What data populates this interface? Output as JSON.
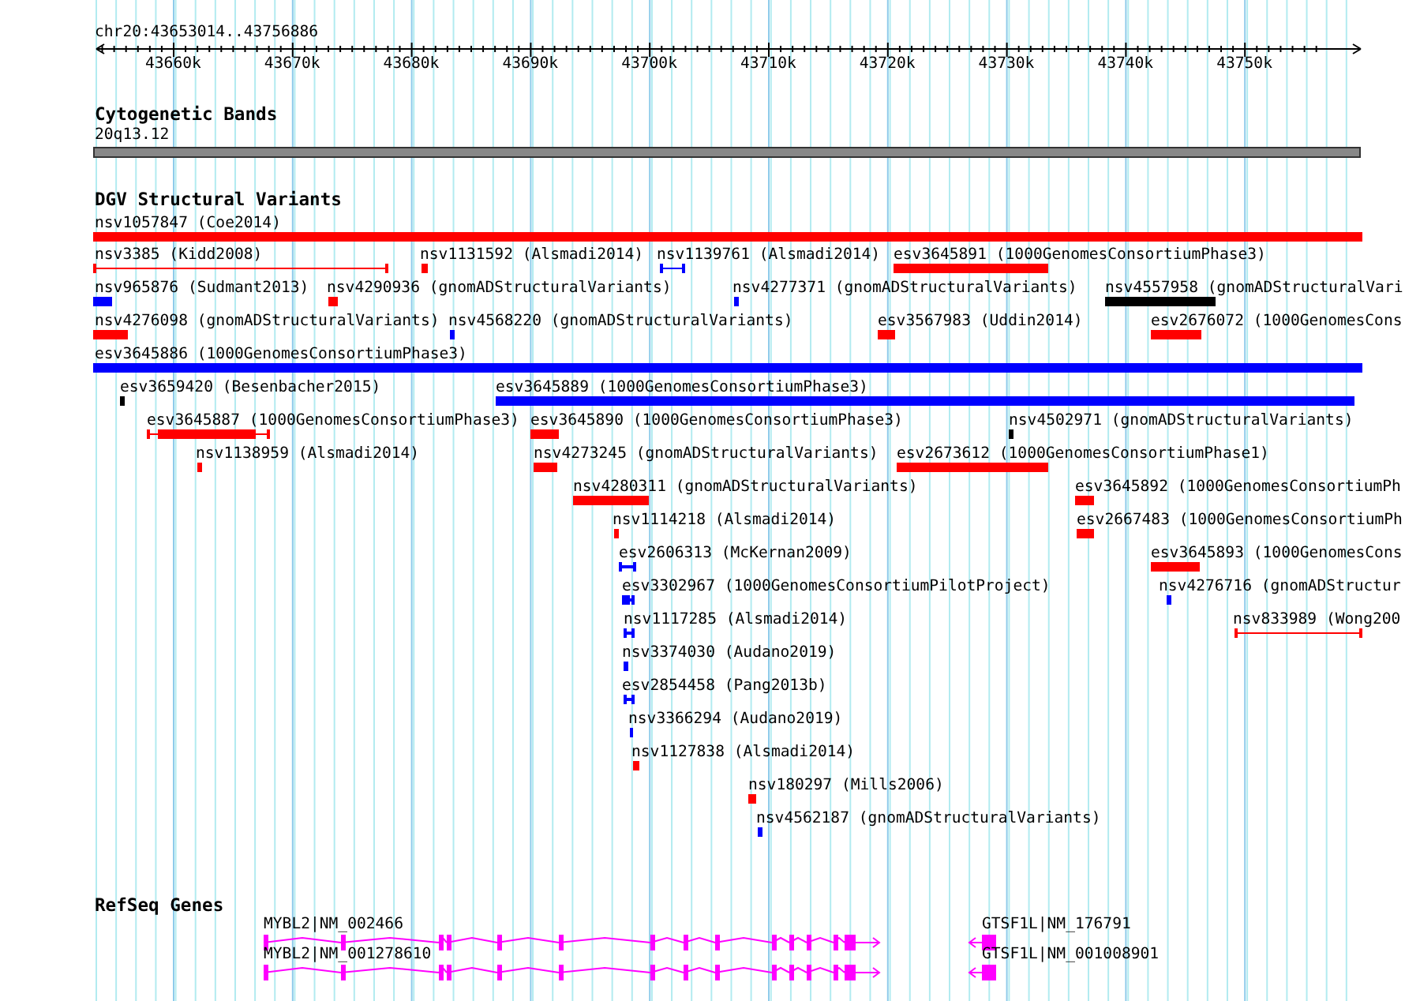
{
  "ruler": {
    "location": "chr20:43653014..43756886",
    "ticks": [
      "43660k",
      "43670k",
      "43680k",
      "43690k",
      "43700k",
      "43710k",
      "43720k",
      "43730k",
      "43740k",
      "43750k"
    ]
  },
  "cytobands": {
    "title": "Cytogenetic Bands",
    "band": "20q13.12"
  },
  "variants": {
    "title": "DGV Structural Variants",
    "features": [
      {
        "label": "nsv1057847 (Coe2014)",
        "color": "#ff0000",
        "kind": "block"
      },
      {
        "label": "nsv3385 (Kidd2008)",
        "color": "#ff0000",
        "kind": "line"
      },
      {
        "label": "nsv1131592 (Alsmadi2014)",
        "color": "#ff0000",
        "kind": "block"
      },
      {
        "label": "nsv1139761 (Alsmadi2014)",
        "color": "#0000ff",
        "kind": "line"
      },
      {
        "label": "esv3645891 (1000GenomesConsortiumPhase3)",
        "color": "#ff0000",
        "kind": "block"
      },
      {
        "label": "nsv965876 (Sudmant2013)",
        "color": "#0000ff",
        "kind": "block"
      },
      {
        "label": "nsv4290936 (gnomADStructuralVariants)",
        "color": "#ff0000",
        "kind": "block"
      },
      {
        "label": "nsv4277371 (gnomADStructuralVariants)",
        "color": "#0000ff",
        "kind": "block"
      },
      {
        "label": "nsv4557958 (gnomADStructuralVari",
        "color": "#000000",
        "kind": "block"
      },
      {
        "label": "nsv4276098 (gnomADStructuralVariants)",
        "color": "#ff0000",
        "kind": "block"
      },
      {
        "label": "nsv4568220 (gnomADStructuralVariants)",
        "color": "#0000ff",
        "kind": "block"
      },
      {
        "label": "esv3567983 (Uddin2014)",
        "color": "#ff0000",
        "kind": "block"
      },
      {
        "label": "esv2676072 (1000GenomesCons",
        "color": "#ff0000",
        "kind": "block"
      },
      {
        "label": "esv3645886 (1000GenomesConsortiumPhase3)",
        "color": "#0000ff",
        "kind": "block"
      },
      {
        "label": "esv3659420 (Besenbacher2015)",
        "color": "#000000",
        "kind": "block"
      },
      {
        "label": "esv3645889 (1000GenomesConsortiumPhase3)",
        "color": "#0000ff",
        "kind": "block"
      },
      {
        "label": "esv3645887 (1000GenomesConsortiumPhase3)",
        "color": "#ff0000",
        "kind": "whisker"
      },
      {
        "label": "esv3645890 (1000GenomesConsortiumPhase3)",
        "color": "#ff0000",
        "kind": "block"
      },
      {
        "label": "nsv4502971 (gnomADStructuralVariants)",
        "color": "#000000",
        "kind": "block"
      },
      {
        "label": "nsv1138959 (Alsmadi2014)",
        "color": "#ff0000",
        "kind": "block"
      },
      {
        "label": "nsv4273245 (gnomADStructuralVariants)",
        "color": "#ff0000",
        "kind": "block"
      },
      {
        "label": "esv2673612 (1000GenomesConsortiumPhase1)",
        "color": "#ff0000",
        "kind": "block"
      },
      {
        "label": "nsv4280311 (gnomADStructuralVariants)",
        "color": "#ff0000",
        "kind": "block"
      },
      {
        "label": "esv3645892 (1000GenomesConsortiumPh",
        "color": "#ff0000",
        "kind": "block"
      },
      {
        "label": "nsv1114218 (Alsmadi2014)",
        "color": "#ff0000",
        "kind": "block"
      },
      {
        "label": "esv2667483 (1000GenomesConsortiumPh",
        "color": "#ff0000",
        "kind": "block"
      },
      {
        "label": "esv2606313 (McKernan2009)",
        "color": "#0000ff",
        "kind": "line"
      },
      {
        "label": "esv3645893 (1000GenomesCons",
        "color": "#ff0000",
        "kind": "block"
      },
      {
        "label": "esv3302967 (1000GenomesConsortiumPilotProject)",
        "color": "#0000ff",
        "kind": "whisker"
      },
      {
        "label": "nsv4276716 (gnomADStructur",
        "color": "#0000ff",
        "kind": "block"
      },
      {
        "label": "nsv1117285 (Alsmadi2014)",
        "color": "#0000ff",
        "kind": "line"
      },
      {
        "label": "nsv833989 (Wong200",
        "color": "#ff0000",
        "kind": "line"
      },
      {
        "label": "nsv3374030 (Audano2019)",
        "color": "#0000ff",
        "kind": "block"
      },
      {
        "label": "esv2854458 (Pang2013b)",
        "color": "#0000ff",
        "kind": "line"
      },
      {
        "label": "nsv3366294 (Audano2019)",
        "color": "#0000ff",
        "kind": "block"
      },
      {
        "label": "nsv1127838 (Alsmadi2014)",
        "color": "#ff0000",
        "kind": "block"
      },
      {
        "label": "nsv180297 (Mills2006)",
        "color": "#ff0000",
        "kind": "block"
      },
      {
        "label": "nsv4562187 (gnomADStructuralVariants)",
        "color": "#0000ff",
        "kind": "block"
      }
    ]
  },
  "genes": {
    "title": "RefSeq Genes",
    "features": [
      {
        "label": "MYBL2|NM_002466",
        "reverse": false
      },
      {
        "label": "MYBL2|NM_001278610",
        "reverse": false
      },
      {
        "label": "GTSF1L|NM_176791",
        "reverse": true
      },
      {
        "label": "GTSF1L|NM_001008901",
        "reverse": true
      }
    ]
  }
}
